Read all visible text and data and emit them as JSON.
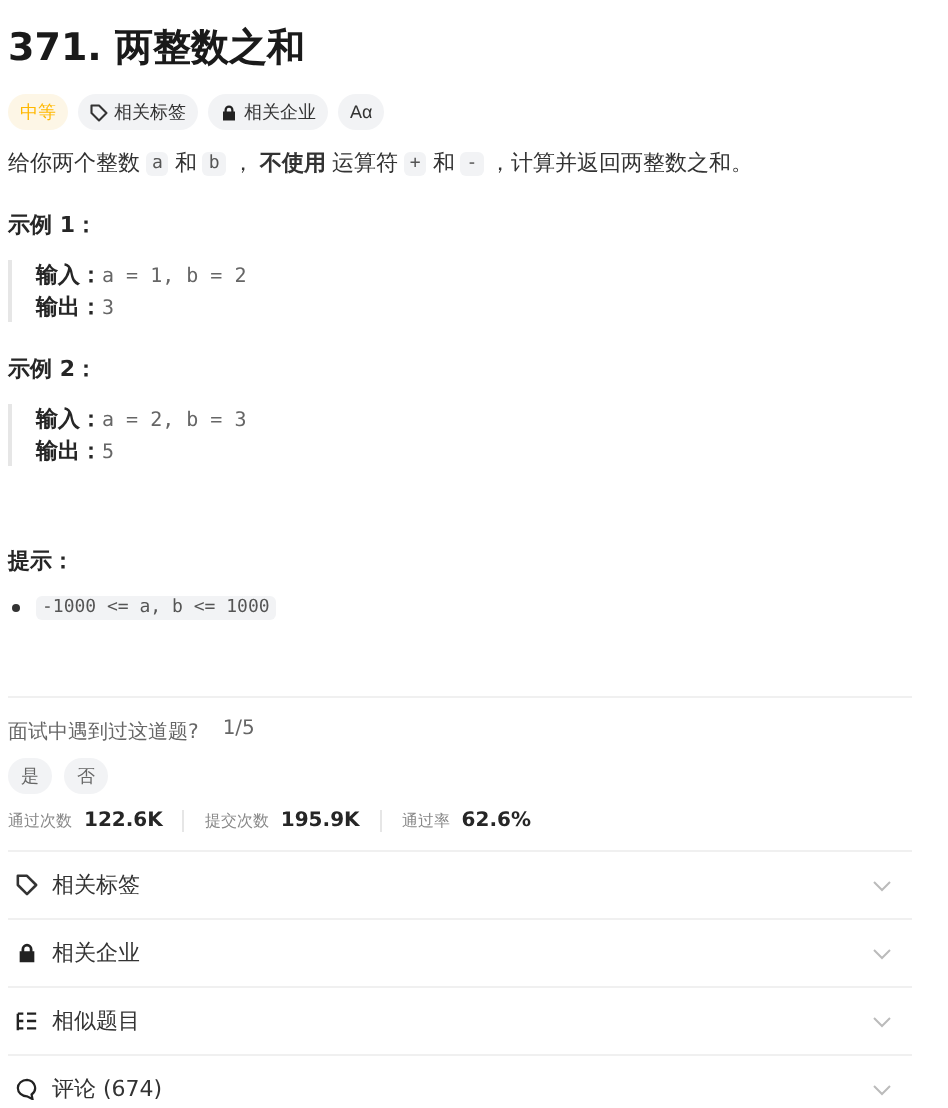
{
  "title": "371. 两整数之和",
  "tags": [
    {
      "kind": "difficulty",
      "label": "中等"
    },
    {
      "kind": "tag",
      "label": "相关标签"
    },
    {
      "kind": "lock",
      "label": "相关企业"
    },
    {
      "kind": "font",
      "label": "Aα"
    }
  ],
  "description": [
    {
      "kind": "text",
      "text": "给你两个整数"
    },
    {
      "kind": "code",
      "text": "a"
    },
    {
      "kind": "text",
      "text": "和"
    },
    {
      "kind": "code",
      "text": "b"
    },
    {
      "kind": "text",
      "text": "，"
    },
    {
      "kind": "bold",
      "text": "不使用"
    },
    {
      "kind": "text",
      "text": "运算符"
    },
    {
      "kind": "code",
      "text": "+"
    },
    {
      "kind": "text",
      "text": "和"
    },
    {
      "kind": "code",
      "text": "-"
    },
    {
      "kind": "text",
      "text": "，计算并返回两整数之和。"
    }
  ],
  "examples": [
    {
      "title": "示例 1：",
      "lines": [
        {
          "label": "输入：",
          "value": "a = 1, b = 2"
        },
        {
          "label": "输出：",
          "value": "3"
        }
      ]
    },
    {
      "title": "示例 2：",
      "lines": [
        {
          "label": "输入：",
          "value": "a = 2, b = 3"
        },
        {
          "label": "输出：",
          "value": "5"
        }
      ]
    }
  ],
  "hints": {
    "title": "提示：",
    "items": [
      "-1000 <= a, b <= 1000"
    ]
  },
  "interview": {
    "question": "面试中遇到过这道题?",
    "count": "1/5",
    "options": [
      "是",
      "否"
    ]
  },
  "stats": [
    {
      "label": "通过次数",
      "value": "122.6K"
    },
    {
      "label": "提交次数",
      "value": "195.9K"
    },
    {
      "label": "通过率",
      "value": "62.6%"
    }
  ],
  "sections": [
    {
      "kind": "tag",
      "label": "相关标签"
    },
    {
      "kind": "lock",
      "label": "相关企业"
    },
    {
      "kind": "list",
      "label": "相似题目"
    },
    {
      "kind": "comment",
      "label": "评论 (674)"
    }
  ]
}
